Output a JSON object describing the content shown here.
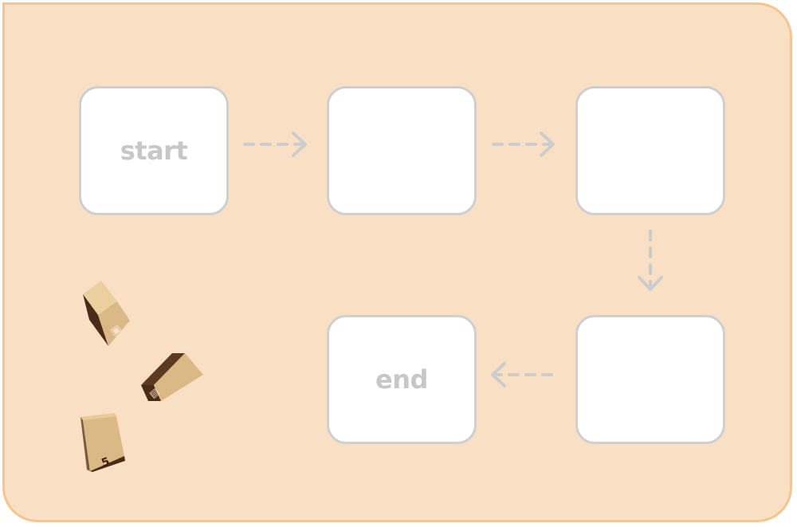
{
  "board": {
    "background_color": "#f9e0c4",
    "border_color": "#f6c58b"
  },
  "slots": [
    {
      "label": "start"
    },
    {
      "label": ""
    },
    {
      "label": ""
    },
    {
      "label": ""
    },
    {
      "label": "end"
    }
  ],
  "connectors": {
    "style": "dashed-arrow",
    "color": "#cccccc"
  },
  "pieces": [
    {
      "name": "box-piece-1",
      "icon": "cardboard-box-icon",
      "glyph": "▣"
    },
    {
      "name": "box-piece-2",
      "icon": "cardboard-box-icon",
      "glyph": "▤"
    },
    {
      "name": "box-piece-3",
      "icon": "cardboard-box-icon",
      "glyph": "5"
    }
  ],
  "colors": {
    "slot_fill": "#ffffff",
    "slot_border": "#cfcfcf",
    "slot_text": "#c7c7c7",
    "box_front": "#dbb986",
    "box_side": "#4a2a18",
    "box_side_light": "#7a5a40"
  }
}
